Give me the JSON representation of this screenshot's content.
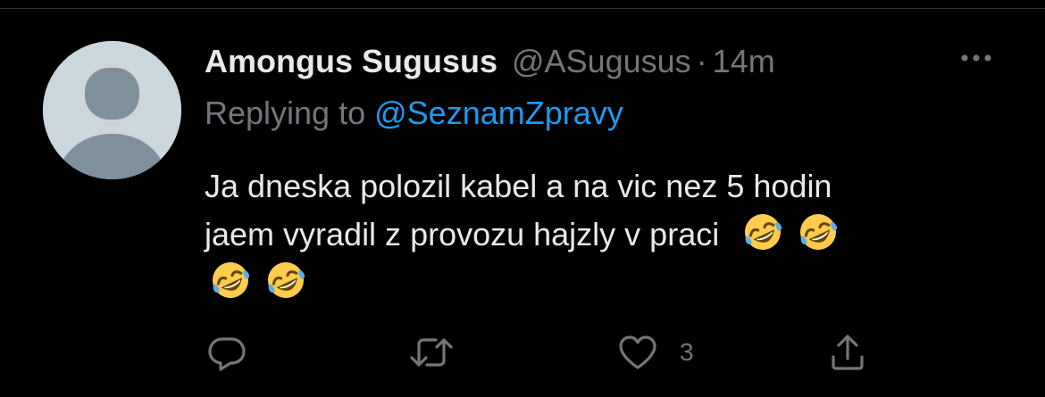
{
  "tweet": {
    "display_name": "Amongus Sugusus",
    "handle": "@ASugusus",
    "separator": "·",
    "time": "14m",
    "reply_prefix": "Replying to",
    "reply_to": "@SeznamZpravy",
    "text_line1": "Ja dneska polozil kabel a na vic nez 5 hodin",
    "text_line2": "jaem vyradil z provozu hajzly v praci",
    "emojis": [
      "rolling-on-floor-laughing",
      "rolling-on-floor-laughing",
      "rolling-on-floor-laughing",
      "rolling-on-floor-laughing"
    ],
    "actions": {
      "reply_count": "",
      "retweet_count": "",
      "like_count": "3",
      "share_count": ""
    }
  },
  "icons": {
    "reply": "reply-icon",
    "retweet": "retweet-icon",
    "like": "heart-icon",
    "share": "share-icon",
    "more": "more-icon"
  },
  "colors": {
    "background": "#000000",
    "text_primary": "#e7e9ea",
    "text_secondary": "#71767b",
    "link": "#1d9bf0",
    "avatar_bg": "#ccd6dd",
    "avatar_fg": "#8899a6"
  }
}
